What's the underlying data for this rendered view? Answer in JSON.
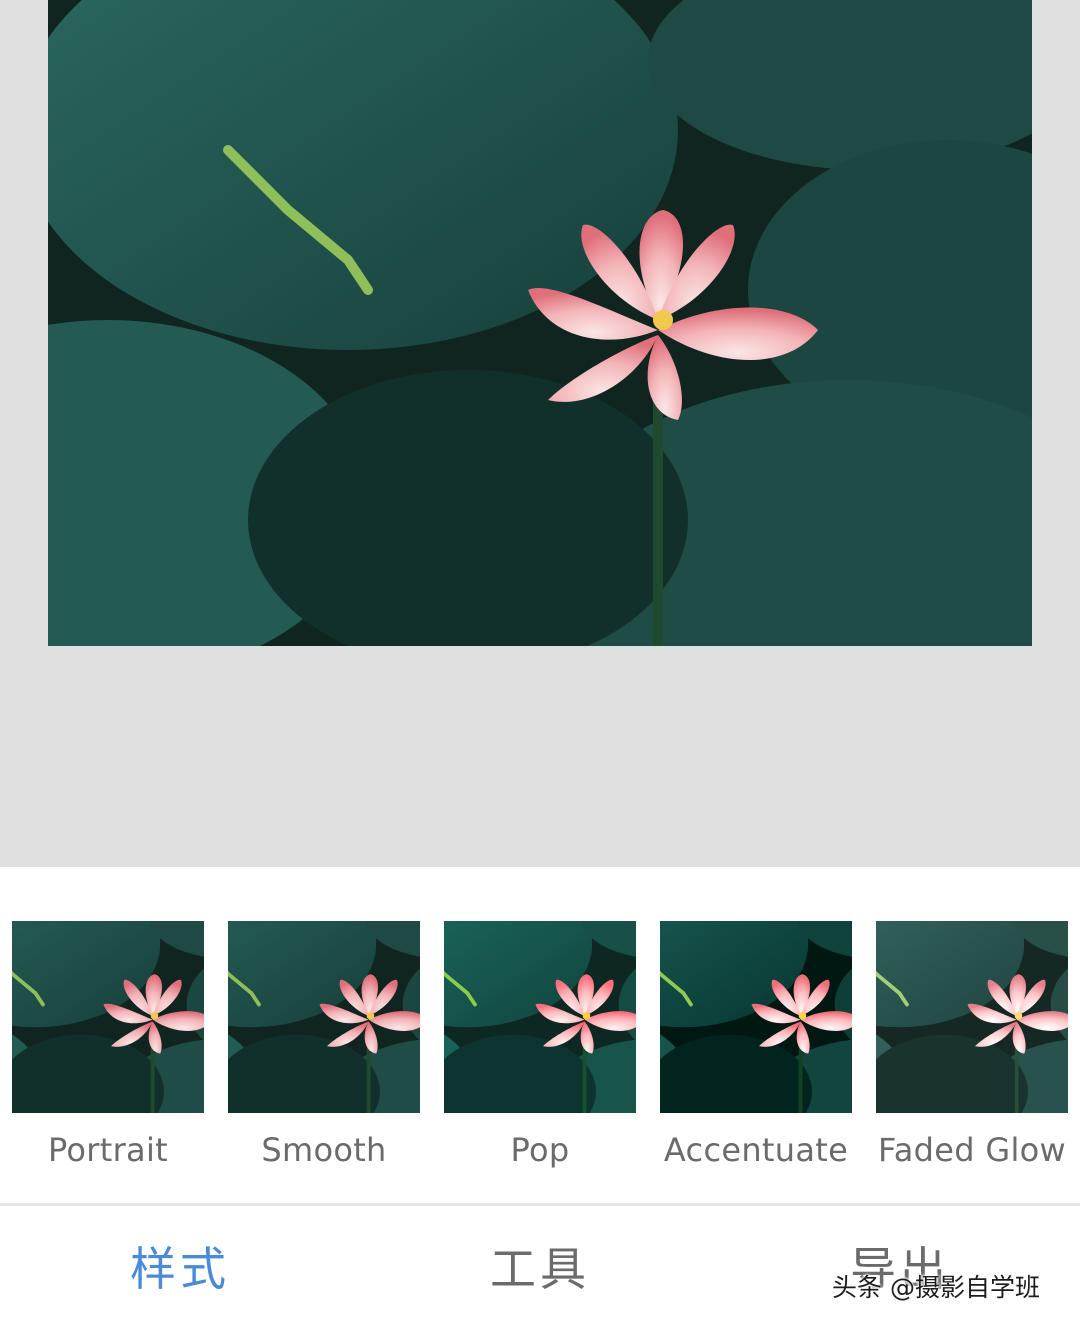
{
  "main_image": {
    "description_icon": "lotus-photo"
  },
  "styles": {
    "items": [
      {
        "label": "Portrait"
      },
      {
        "label": "Smooth"
      },
      {
        "label": "Pop"
      },
      {
        "label": "Accentuate"
      },
      {
        "label": "Faded Glow"
      }
    ]
  },
  "tabs": {
    "styles": "样式",
    "tools": "工具",
    "export": "导出"
  },
  "watermark": "头条 @摄影自学班",
  "colors": {
    "accent": "#4a8ad8",
    "label": "#6b6b6b",
    "canvas_bg": "#e0e0e0"
  }
}
